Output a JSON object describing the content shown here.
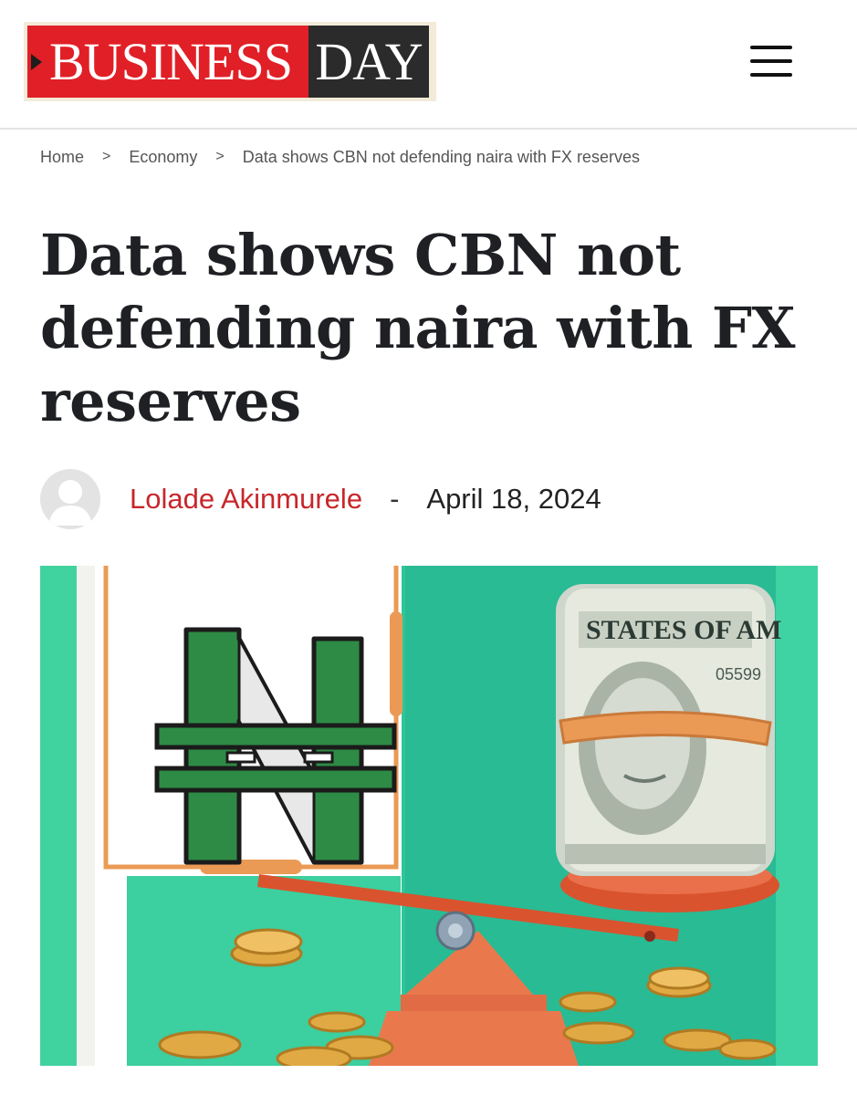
{
  "header": {
    "logo_left": "BUSINESS",
    "logo_right": "DAY",
    "menu_icon": "hamburger-menu-icon"
  },
  "breadcrumb": {
    "items": [
      "Home",
      "Economy",
      "Data shows CBN not defending naira with FX reserves"
    ],
    "separator": ">"
  },
  "article": {
    "title": "Data shows CBN not defending naira with FX reserves",
    "author": "Lolade Akinmurele",
    "separator": "-",
    "date": "April 18, 2024"
  },
  "hero_image": {
    "note_text_top": "STATES OF AM",
    "note_serial": "05599"
  },
  "colors": {
    "brand_red": "#e11f26",
    "brand_dark": "#2b2b2b",
    "author_red": "#c8262b",
    "teal": "#2cc79a",
    "naira_green": "#2e8b45",
    "scale_orange": "#e0593a"
  }
}
